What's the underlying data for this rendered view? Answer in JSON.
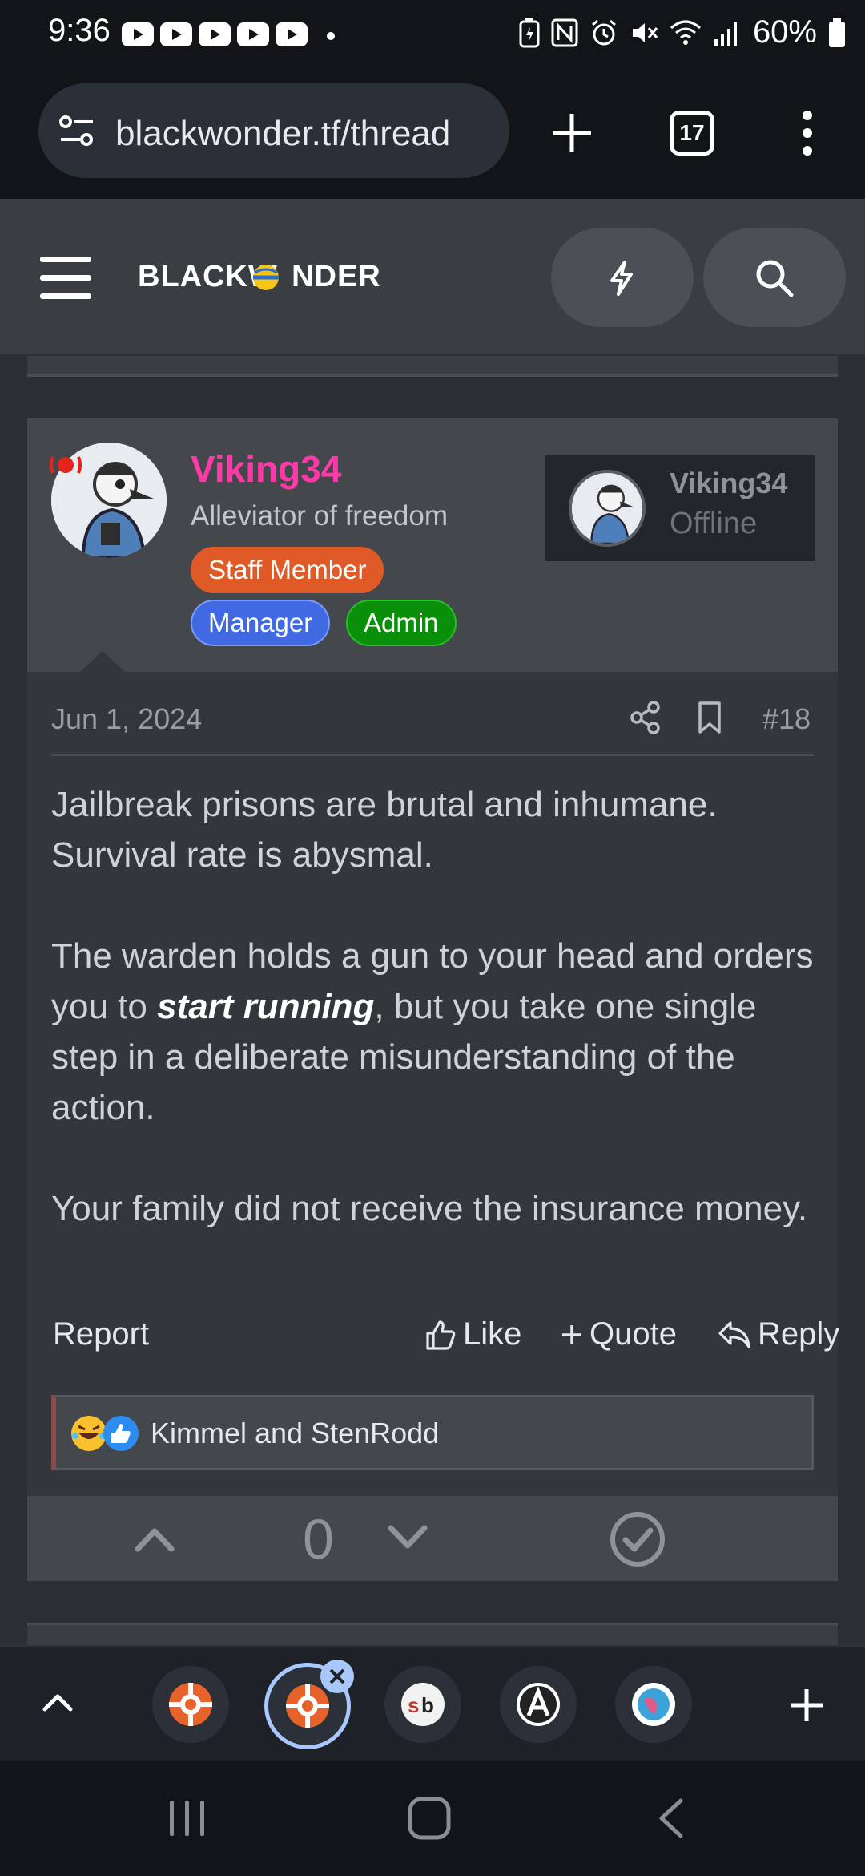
{
  "status_bar": {
    "time": "9:36",
    "battery_percent": "60%",
    "icons": [
      "youtube-icon",
      "youtube-icon",
      "youtube-icon",
      "youtube-icon",
      "youtube-icon",
      "dot-icon",
      "battery-saver-icon",
      "nfc-icon",
      "alarm-icon",
      "mute-icon",
      "wifi-icon",
      "signal-icon",
      "battery-icon"
    ]
  },
  "browser": {
    "url": "blackwonder.tf/thread",
    "tab_count": "17"
  },
  "site": {
    "logo": "BLACKW  NDER"
  },
  "post": {
    "user": {
      "name": "Viking34",
      "title": "Alleviator of freedom",
      "badges": {
        "staff": "Staff Member",
        "manager": "Manager",
        "admin": "Admin"
      }
    },
    "user_card": {
      "name": "Viking34",
      "status": "Offline"
    },
    "date": "Jun 1, 2024",
    "number": "#18",
    "body": {
      "p1": "Jailbreak prisons are brutal and inhumane. Survival rate is abysmal.",
      "p2_before": "The warden holds a gun to your head and orders you to ",
      "p2_emph": "start running",
      "p2_after": ", but you take one single step in a deliberate misunderstanding of the action.",
      "p3": "Your family did not receive the insurance money."
    },
    "actions": {
      "report": "Report",
      "like": "Like",
      "quote": "Quote",
      "reply": "Reply"
    },
    "reactions": {
      "text": "Kimmel and StenRodd",
      "emojis": [
        "rofl-emoji",
        "thumbs-up-emoji"
      ]
    },
    "votes": {
      "score": "0"
    }
  },
  "colors": {
    "username": "#ff3aa8",
    "staff_badge": "#e05a28",
    "manager_badge": "#4169e1",
    "admin_badge": "#0a8f0a",
    "active_tab_ring": "#a8c7fa"
  }
}
